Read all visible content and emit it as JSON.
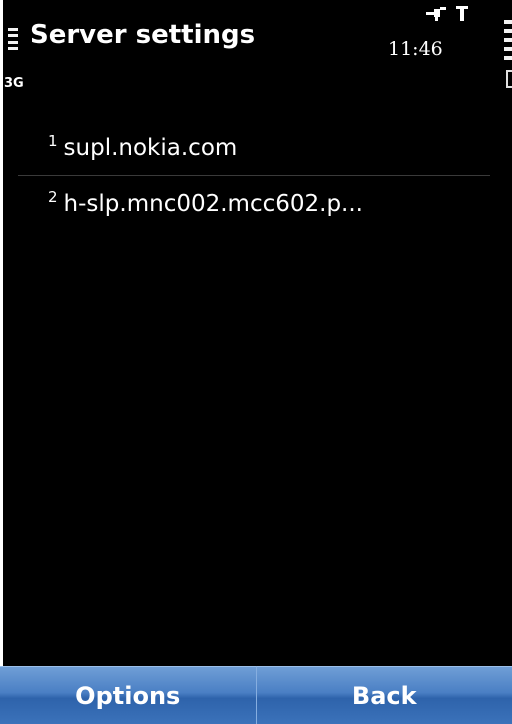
{
  "status_bar": {
    "title": "Server settings",
    "network_type": "3G",
    "time": "11:46",
    "icons": [
      "signal-strength-icon",
      "gps-satellite-icon",
      "antenna-icon",
      "battery-icon"
    ]
  },
  "servers": [
    {
      "index": "1",
      "address": "supl.nokia.com"
    },
    {
      "index": "2",
      "address": "h-slp.mnc002.mcc602.p..."
    }
  ],
  "softkeys": {
    "options_label": "Options",
    "back_label": "Back"
  },
  "colors": {
    "background": "#000000",
    "text": "#ffffff",
    "softkey_blue": "#4a7fc4"
  }
}
